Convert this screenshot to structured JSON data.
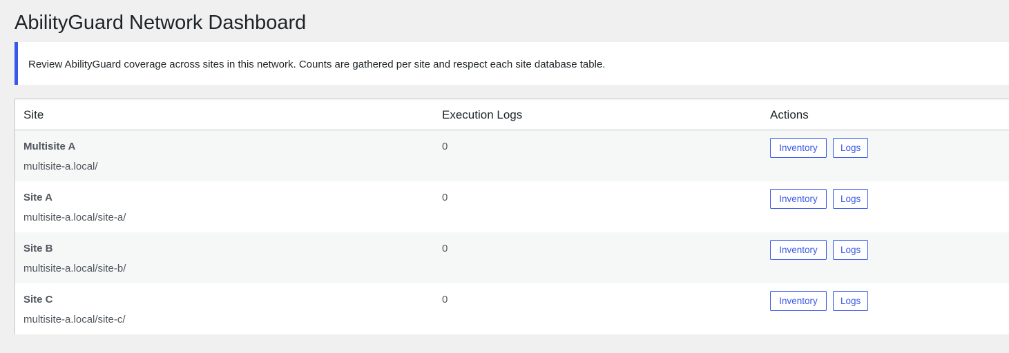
{
  "page": {
    "title": "AbilityGuard Network Dashboard"
  },
  "notice": {
    "text": "Review AbilityGuard coverage across sites in this network. Counts are gathered per site and respect each site database table."
  },
  "table": {
    "columns": {
      "site": "Site",
      "logs": "Execution Logs",
      "actions": "Actions"
    },
    "rows": [
      {
        "name": "Multisite A",
        "url": "multisite-a.local/",
        "logs": "0",
        "inventory_label": "Inventory",
        "logs_label": "Logs"
      },
      {
        "name": "Site A",
        "url": "multisite-a.local/site-a/",
        "logs": "0",
        "inventory_label": "Inventory",
        "logs_label": "Logs"
      },
      {
        "name": "Site B",
        "url": "multisite-a.local/site-b/",
        "logs": "0",
        "inventory_label": "Inventory",
        "logs_label": "Logs"
      },
      {
        "name": "Site C",
        "url": "multisite-a.local/site-c/",
        "logs": "0",
        "inventory_label": "Inventory",
        "logs_label": "Logs"
      }
    ]
  },
  "colors": {
    "accent": "#3858e9",
    "background": "#f0f0f1",
    "row_alt": "#f6f7f7",
    "border": "#c3c4c7"
  }
}
